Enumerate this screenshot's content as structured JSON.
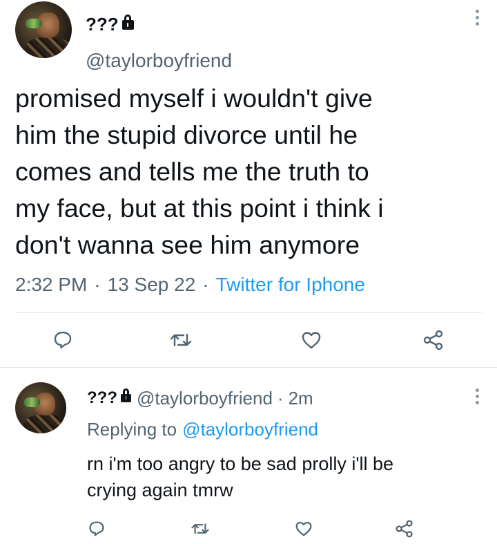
{
  "main_tweet": {
    "display_name": "???",
    "handle": "@taylorboyfriend",
    "text": "promised myself i wouldn't give\nhim the stupid divorce until he\ncomes and tells me the truth to\nmy face, but at this point i think i\ndon't wanna see him anymore",
    "time": "2:32 PM",
    "separator1": "·",
    "date": "13 Sep 22",
    "separator2": "·",
    "source": "Twitter for Iphone",
    "icons": [
      "reply-icon",
      "retweet-icon",
      "like-icon",
      "share-icon"
    ]
  },
  "reply_tweet": {
    "display_name": "???",
    "handle": "@taylorboyfriend",
    "separator": "·",
    "age": "2m",
    "replying_label": "Replying to",
    "replying_to": "@taylorboyfriend",
    "text": "rn i'm too angry to be sad prolly i'll be\ncrying again tmrw",
    "icons": [
      "reply-icon",
      "retweet-icon",
      "like-icon",
      "share-icon"
    ]
  },
  "colors": {
    "text": "#0f1419",
    "secondary": "#536471",
    "link": "#1d9bf0",
    "divider": "#dfe3e6"
  }
}
